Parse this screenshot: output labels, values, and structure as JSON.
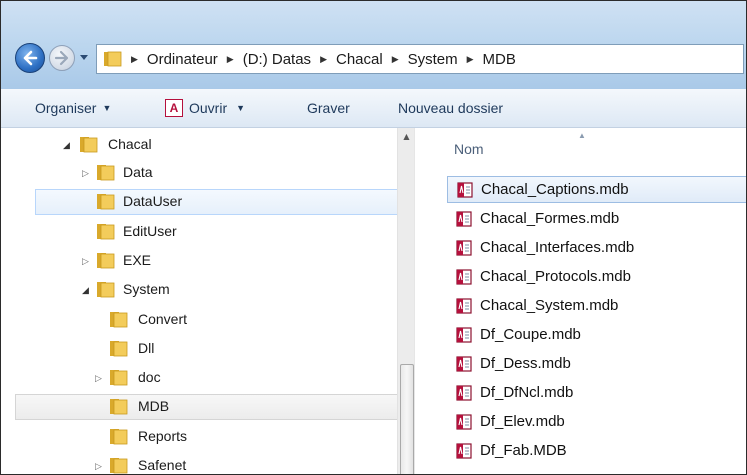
{
  "address": {
    "crumbs": [
      "Ordinateur",
      "(D:) Datas",
      "Chacal",
      "System",
      "MDB"
    ]
  },
  "toolbar": {
    "organize_label": "Organiser",
    "open_label": "Ouvrir",
    "burn_label": "Graver",
    "new_folder_label": "Nouveau dossier"
  },
  "nav": {
    "items": [
      {
        "label": "Chacal",
        "expander": "open",
        "state": "normal"
      },
      {
        "label": "Data",
        "expander": "closed",
        "state": "normal"
      },
      {
        "label": "DataUser",
        "expander": "none",
        "state": "hover"
      },
      {
        "label": "EditUser",
        "expander": "none",
        "state": "normal"
      },
      {
        "label": "EXE",
        "expander": "closed",
        "state": "normal"
      },
      {
        "label": "System",
        "expander": "open",
        "state": "normal"
      },
      {
        "label": "Convert",
        "expander": "none",
        "state": "normal"
      },
      {
        "label": "Dll",
        "expander": "none",
        "state": "normal"
      },
      {
        "label": "doc",
        "expander": "closed",
        "state": "normal"
      },
      {
        "label": "MDB",
        "expander": "none",
        "state": "selected"
      },
      {
        "label": "Reports",
        "expander": "none",
        "state": "normal"
      },
      {
        "label": "Safenet",
        "expander": "closed",
        "state": "normal"
      }
    ]
  },
  "files": {
    "column_name": "Nom",
    "items": [
      {
        "name": "Chacal_Captions.mdb",
        "selected": true
      },
      {
        "name": "Chacal_Formes.mdb",
        "selected": false
      },
      {
        "name": "Chacal_Interfaces.mdb",
        "selected": false
      },
      {
        "name": "Chacal_Protocols.mdb",
        "selected": false
      },
      {
        "name": "Chacal_System.mdb",
        "selected": false
      },
      {
        "name": "Df_Coupe.mdb",
        "selected": false
      },
      {
        "name": "Df_Dess.mdb",
        "selected": false
      },
      {
        "name": "Df_DfNcl.mdb",
        "selected": false
      },
      {
        "name": "Df_Elev.mdb",
        "selected": false
      },
      {
        "name": "Df_Fab.MDB",
        "selected": false
      }
    ]
  },
  "colors": {
    "selection_border": "#9dbde3",
    "access_red": "#b5103c",
    "folder_yellow": "#f2c94c"
  }
}
